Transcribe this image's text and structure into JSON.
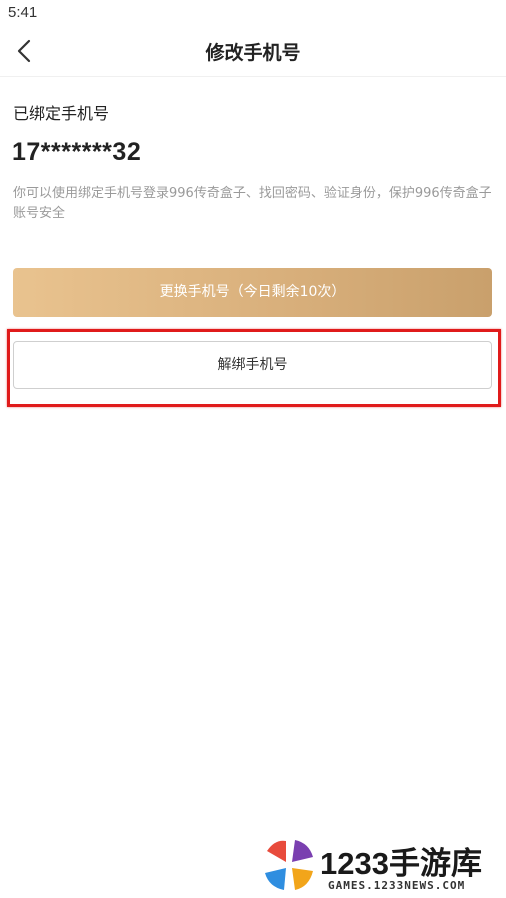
{
  "status_bar": {
    "time": "5:41"
  },
  "nav": {
    "back_icon": "chevron-left-icon",
    "title": "修改手机号"
  },
  "account": {
    "bound_label": "已绑定手机号",
    "phone_masked": "17*******32",
    "hint": "你可以使用绑定手机号登录996传奇盒子、找回密码、验证身份，保护996传奇盒子账号安全"
  },
  "actions": {
    "change_label": "更换手机号（今日剩余10次）",
    "unbind_label": "解绑手机号"
  },
  "colors": {
    "accent_gold_start": "#e9c38f",
    "accent_gold_end": "#c9a06c",
    "highlight_red": "#e01b1b",
    "hint_gray": "#9a9a9a"
  },
  "watermark": {
    "title": "1233手游库",
    "subtitle": "GAMES.1233NEWS.COM"
  }
}
